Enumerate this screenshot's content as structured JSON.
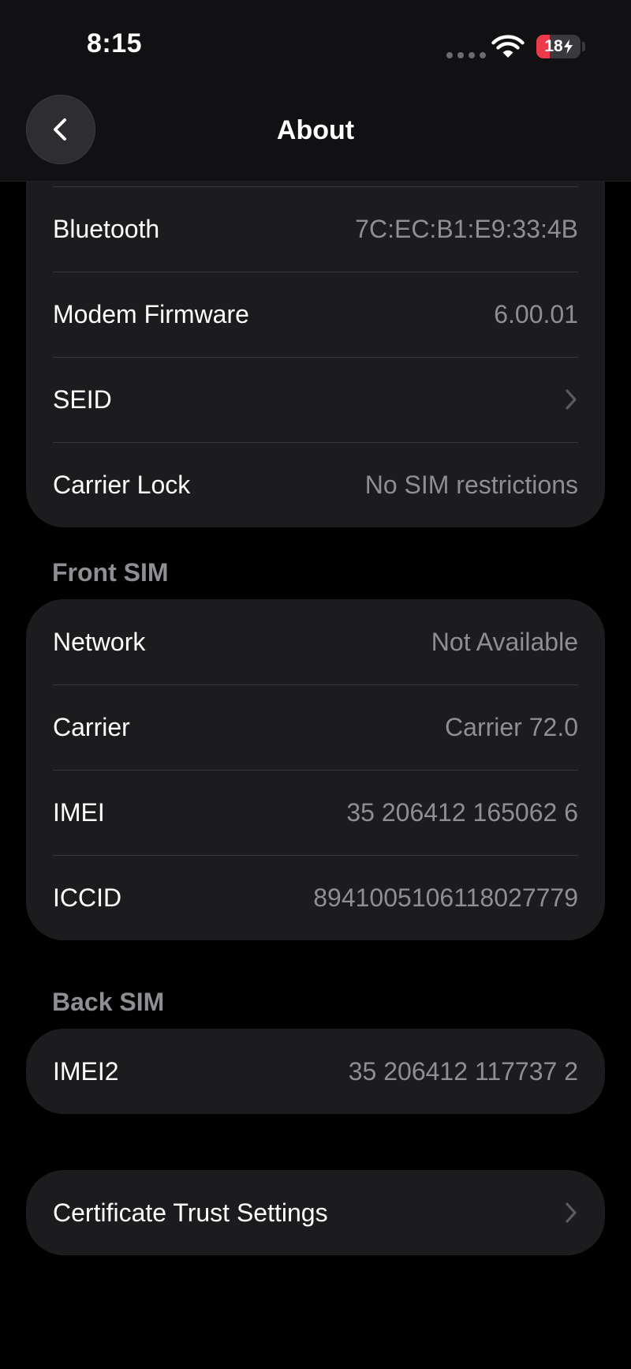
{
  "status_bar": {
    "time": "8:15",
    "battery_level": "18",
    "battery_fraction": 0.18,
    "battery_color": "#eb3b4a"
  },
  "nav": {
    "title": "About",
    "back_icon": "chevron-left-icon"
  },
  "network_group": {
    "rows": [
      {
        "label": "Bluetooth",
        "value": "7C:EC:B1:E9:33:4B"
      },
      {
        "label": "Modem Firmware",
        "value": "6.00.01"
      },
      {
        "label": "SEID",
        "icon": "chevron-right-icon"
      },
      {
        "label": "Carrier Lock",
        "value": "No SIM restrictions"
      }
    ]
  },
  "front_sim": {
    "header": "Front SIM",
    "rows": [
      {
        "label": "Network",
        "value": "Not Available"
      },
      {
        "label": "Carrier",
        "value": "Carrier 72.0"
      },
      {
        "label": "IMEI",
        "value": "35 206412 165062 6"
      },
      {
        "label": "ICCID",
        "value": "8941005106118027779"
      }
    ]
  },
  "back_sim": {
    "header": "Back SIM",
    "rows": [
      {
        "label": "IMEI2",
        "value": "35 206412 117737 2"
      }
    ]
  },
  "certificate": {
    "label": "Certificate Trust Settings",
    "icon": "chevron-right-icon"
  },
  "colors": {
    "background": "#000000",
    "group_background": "#1c1c1e",
    "secondary_text": "#8e8e93"
  }
}
